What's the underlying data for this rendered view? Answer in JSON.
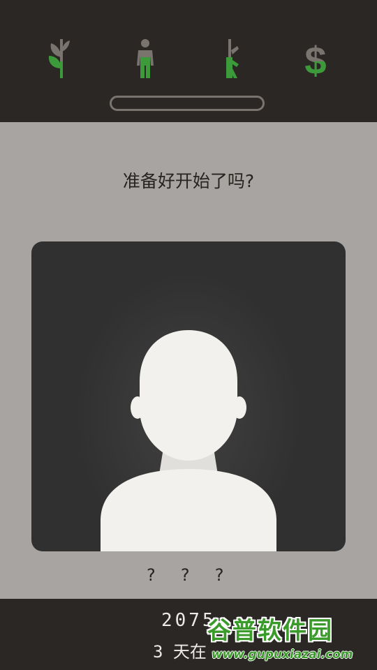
{
  "stats": {
    "icons": [
      "church-icon",
      "people-icon",
      "army-icon",
      "money-icon"
    ],
    "accent_color": "#3d9a3a",
    "muted_color": "#7a746f",
    "progress": 0
  },
  "question": "准备好开始了吗?",
  "character": {
    "name": "? ? ?"
  },
  "footer": {
    "year": "2075",
    "days": "3 天在"
  },
  "watermark": {
    "title": "谷普软件园",
    "url": "www.gupuxiazai.com"
  }
}
